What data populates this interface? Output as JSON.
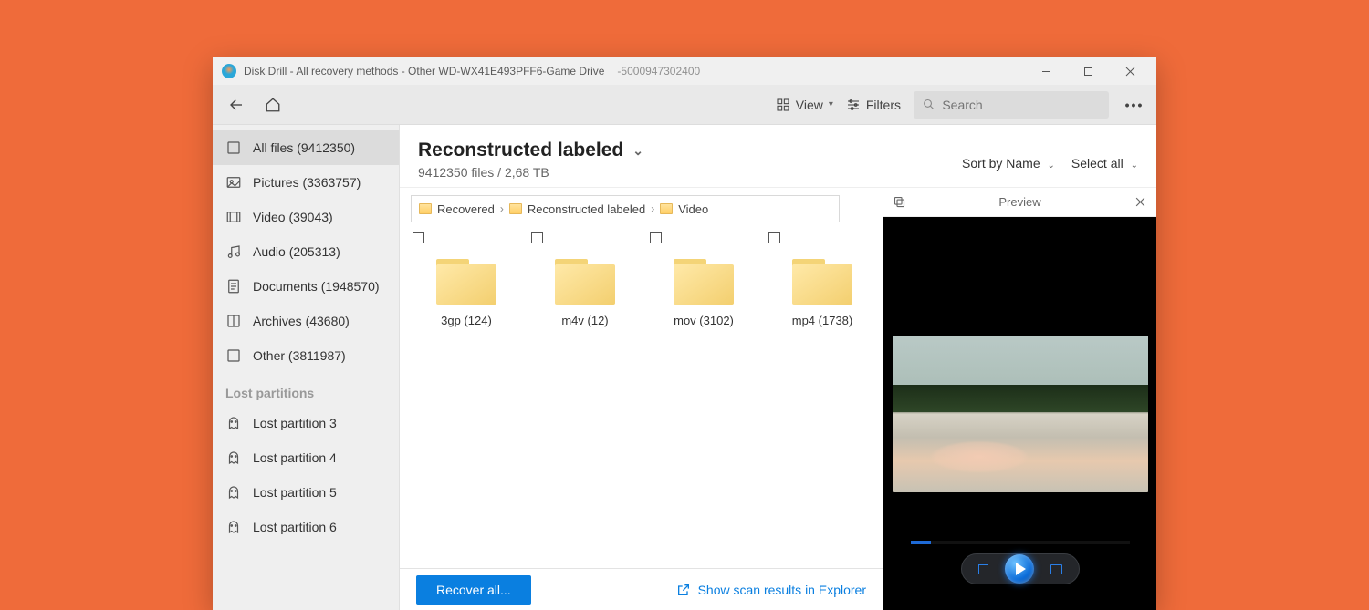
{
  "window": {
    "title": "Disk Drill - All recovery methods - Other WD-WX41E493PFF6-Game Drive",
    "subtitle": "-5000947302400"
  },
  "toolbar": {
    "view_label": "View",
    "filters_label": "Filters",
    "search_placeholder": "Search"
  },
  "sidebar": {
    "items": [
      {
        "label": "All files (9412350)",
        "icon": "files"
      },
      {
        "label": "Pictures (3363757)",
        "icon": "pictures"
      },
      {
        "label": "Video (39043)",
        "icon": "video"
      },
      {
        "label": "Audio (205313)",
        "icon": "audio"
      },
      {
        "label": "Documents (1948570)",
        "icon": "documents"
      },
      {
        "label": "Archives (43680)",
        "icon": "archives"
      },
      {
        "label": "Other (3811987)",
        "icon": "other"
      }
    ],
    "section": "Lost partitions",
    "partitions": [
      {
        "label": "Lost partition 3"
      },
      {
        "label": "Lost partition 4"
      },
      {
        "label": "Lost partition 5"
      },
      {
        "label": "Lost partition 6"
      }
    ]
  },
  "main": {
    "title": "Reconstructed labeled",
    "subtitle": "9412350 files / 2,68 TB",
    "sort_label": "Sort by Name",
    "select_label": "Select all",
    "breadcrumb": [
      "Recovered",
      "Reconstructed labeled",
      "Video"
    ],
    "folders": [
      {
        "name": "3gp (124)"
      },
      {
        "name": "m4v (12)"
      },
      {
        "name": "mov (3102)"
      },
      {
        "name": "mp4 (1738)"
      }
    ]
  },
  "bottom": {
    "recover": "Recover all...",
    "explorer": "Show scan results in Explorer"
  },
  "preview": {
    "title": "Preview"
  }
}
